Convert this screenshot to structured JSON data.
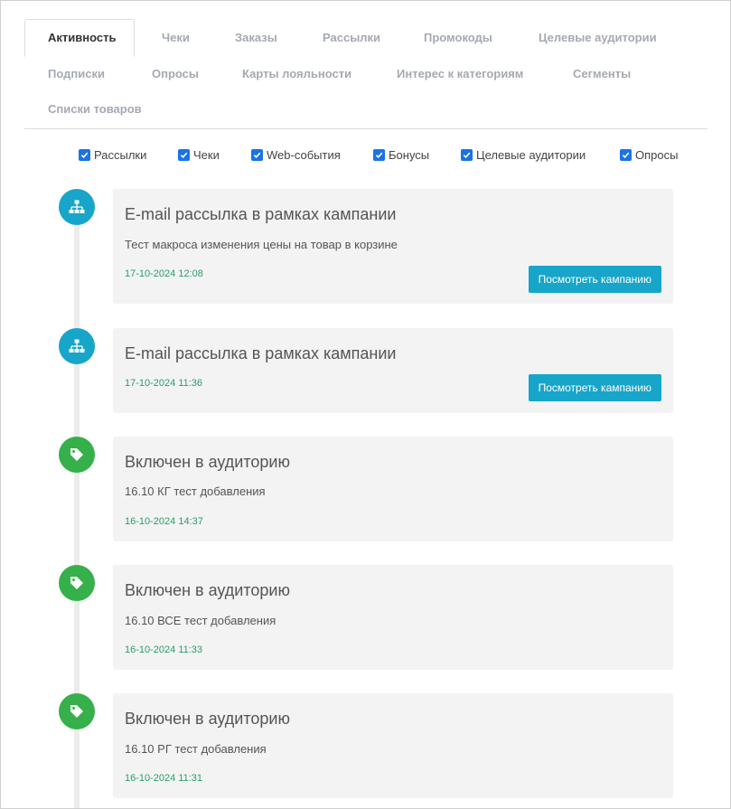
{
  "tabs": [
    {
      "label": "Активность",
      "active": true
    },
    {
      "label": "Чеки"
    },
    {
      "label": "Заказы"
    },
    {
      "label": "Рассылки"
    },
    {
      "label": "Промокоды"
    },
    {
      "label": "Целевые аудитории"
    },
    {
      "label": "Подписки"
    },
    {
      "label": "Опросы"
    },
    {
      "label": "Карты лояльности"
    },
    {
      "label": "Интерес к категориям"
    },
    {
      "label": "Сегменты"
    },
    {
      "label": "Списки товаров"
    }
  ],
  "filters": [
    {
      "label": "Рассылки",
      "checked": true
    },
    {
      "label": "Чеки",
      "checked": true
    },
    {
      "label": "Web-события",
      "checked": true
    },
    {
      "label": "Бонусы",
      "checked": true
    },
    {
      "label": "Целевые аудитории",
      "checked": true
    },
    {
      "label": "Опросы",
      "checked": true
    }
  ],
  "events": [
    {
      "icon": "sitemap-icon",
      "color": "#17a5c9",
      "title": "E-mail рассылка в рамках кампании",
      "description": "Тест макроса изменения цены на товар в корзине",
      "date": "17-10-2024 12:08",
      "button": "Посмотреть кампанию"
    },
    {
      "icon": "sitemap-icon",
      "color": "#17a5c9",
      "title": "E-mail рассылка в рамках кампании",
      "date": "17-10-2024 11:36",
      "button": "Посмотреть кампанию"
    },
    {
      "icon": "tag-icon",
      "color": "#35b04a",
      "title": "Включен в аудиторию",
      "description": "16.10 КГ тест добавления",
      "date": "16-10-2024 14:37"
    },
    {
      "icon": "tag-icon",
      "color": "#35b04a",
      "title": "Включен в аудиторию",
      "description": "16.10 ВСЕ тест добавления",
      "date": "16-10-2024 11:33"
    },
    {
      "icon": "tag-icon",
      "color": "#35b04a",
      "title": "Включен в аудиторию",
      "description": "16.10 РГ тест добавления",
      "date": "16-10-2024 11:31"
    }
  ]
}
